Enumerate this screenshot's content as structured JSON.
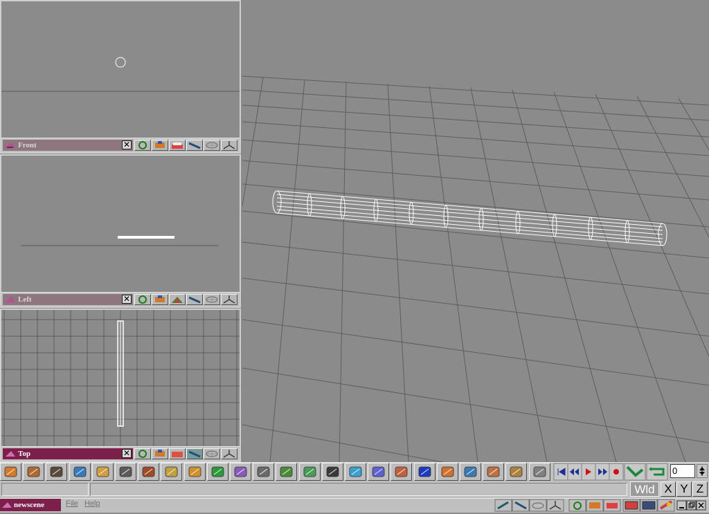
{
  "viewports": {
    "front": {
      "title": "Front"
    },
    "left": {
      "title": "Left"
    },
    "top": {
      "title": "Top"
    }
  },
  "viewport_toolbar_icons": [
    "orbit-icon",
    "pan-icon",
    "render-preview-icon",
    "walk-icon",
    "wireframe-icon",
    "axis-icon"
  ],
  "main_toolbar": {
    "icons": [
      "bridge-icon",
      "cylinder-icon",
      "camera-icon",
      "select-arrow-icon",
      "transform-icon",
      "bone-icon",
      "box-icon",
      "extrude-icon",
      "sphere-icon",
      "material-icon",
      "blob-icon",
      "spline-icon",
      "path-icon",
      "lathe-icon",
      "film-strip-icon",
      "cube-icon",
      "figure-icon",
      "deform-icon",
      "grid-icon",
      "platform-icon",
      "3d-view-icon",
      "boolean-icon",
      "rotate-icon",
      "scale-icon"
    ],
    "playback": [
      "first-frame-icon",
      "rewind-icon",
      "play-icon",
      "fast-forward-icon",
      "record-icon",
      "keyframe-icon",
      "loop-icon"
    ],
    "frame_value": "0"
  },
  "bottom": {
    "axis_mode": "Wld",
    "axes": [
      "X",
      "Y",
      "Z"
    ],
    "app_title": "newscene",
    "menu": {
      "file": "File",
      "help": "Help"
    }
  },
  "colors": {
    "active_title": "#7d1f4b",
    "inactive_title": "#8e767e",
    "viewport_bg": "#8b8b8b",
    "grid_line": "#5a5a5a"
  }
}
